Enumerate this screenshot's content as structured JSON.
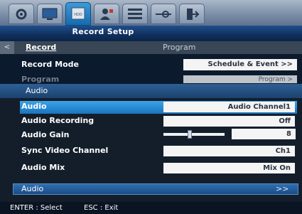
{
  "window": {
    "title": "Record Setup"
  },
  "tabs": [
    {
      "icon": "gear-icon"
    },
    {
      "icon": "monitor-icon"
    },
    {
      "icon": "hdd-icon",
      "label": "HDD",
      "active": true
    },
    {
      "icon": "user-icon"
    },
    {
      "icon": "network-icon"
    },
    {
      "icon": "settings-slider-icon"
    },
    {
      "icon": "exit-icon"
    }
  ],
  "subtabs": {
    "left_arrow": "<",
    "record": "Record",
    "program": "Program"
  },
  "record_page": {
    "record_mode_label": "Record Mode",
    "record_mode_value": "Schedule & Event >>",
    "program_label": "Program",
    "program_value": "Program >"
  },
  "audio_popup": {
    "title": "Audio",
    "rows": [
      {
        "label": "Audio",
        "value": "Audio Channel1"
      },
      {
        "label": "Audio Recording",
        "value": "Off"
      },
      {
        "label": "Audio Gain",
        "value": "8",
        "level": 0.42
      },
      {
        "label": "Sync Video Channel",
        "value": "Ch1"
      },
      {
        "label": "Audio Mix",
        "value": "Mix On"
      }
    ],
    "footer_label": "Audio",
    "footer_arrows": ">>"
  },
  "status": {
    "enter": "ENTER : Select",
    "esc": "ESC : Exit"
  },
  "colors": {
    "accent": "#1b74bc",
    "header": "#1c426f",
    "background": "#0c1a2e"
  }
}
